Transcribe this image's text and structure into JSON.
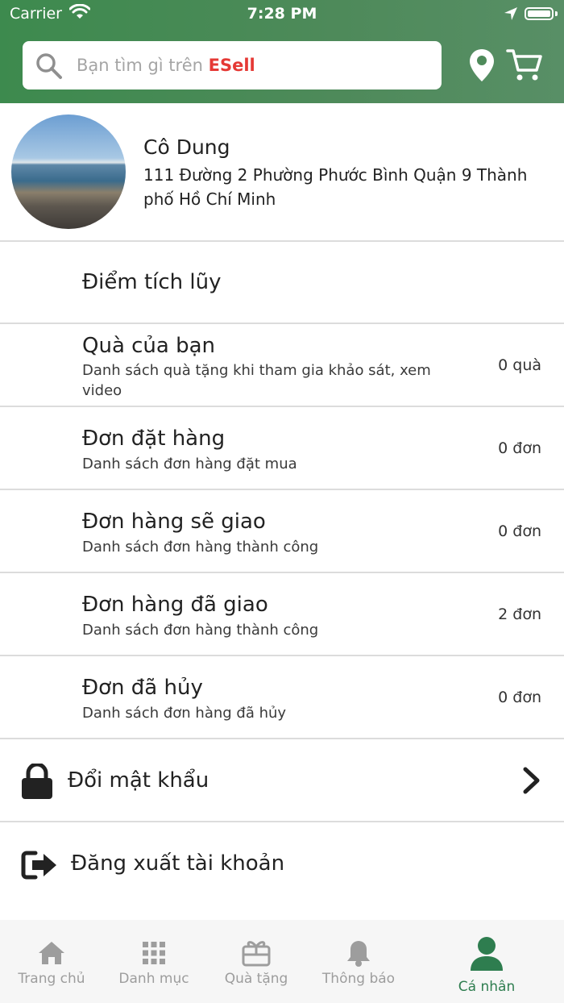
{
  "status_bar": {
    "carrier": "Carrier",
    "time": "7:28 PM"
  },
  "header": {
    "search_placeholder": "Bạn tìm gì trên ",
    "brand": "ESell",
    "brand_color": "#e53935",
    "icons": [
      "search-icon",
      "location-pin-icon",
      "cart-icon"
    ],
    "background_color": "#4e8a5a"
  },
  "profile": {
    "name": "Cô Dung",
    "address": "111 Đường 2 Phường Phước Bình Quận 9 Thành phố Hồ Chí Minh"
  },
  "menu": [
    {
      "title": "Điểm tích lũy",
      "subtitle": "",
      "count": ""
    },
    {
      "title": "Quà của bạn",
      "subtitle": "Danh sách quà tặng khi tham gia khảo sát, xem video",
      "count": "0 quà"
    },
    {
      "title": "Đơn đặt hàng",
      "subtitle": "Danh sách đơn hàng đặt mua",
      "count": "0 đơn"
    },
    {
      "title": "Đơn hàng sẽ giao",
      "subtitle": "Danh sách đơn hàng thành công",
      "count": "0 đơn"
    },
    {
      "title": "Đơn hàng đã giao",
      "subtitle": "Danh sách đơn hàng thành công",
      "count": "2 đơn"
    },
    {
      "title": "Đơn đã hủy",
      "subtitle": "Danh sách đơn hàng đã hủy",
      "count": "0 đơn"
    }
  ],
  "actions": {
    "change_password": "Đổi mật khẩu",
    "logout": "Đăng xuất tài khoản"
  },
  "tabbar": {
    "items": [
      {
        "label": "Trang chủ",
        "icon": "home-icon"
      },
      {
        "label": "Danh mục",
        "icon": "grid-icon"
      },
      {
        "label": "Quà tặng",
        "icon": "gift-icon"
      },
      {
        "label": "Thông báo",
        "icon": "bell-icon"
      },
      {
        "label": "Cá nhân",
        "icon": "user-icon"
      }
    ],
    "active": "Cá nhân",
    "active_color": "#2e7d4f",
    "inactive_color": "#9d9d9d"
  }
}
